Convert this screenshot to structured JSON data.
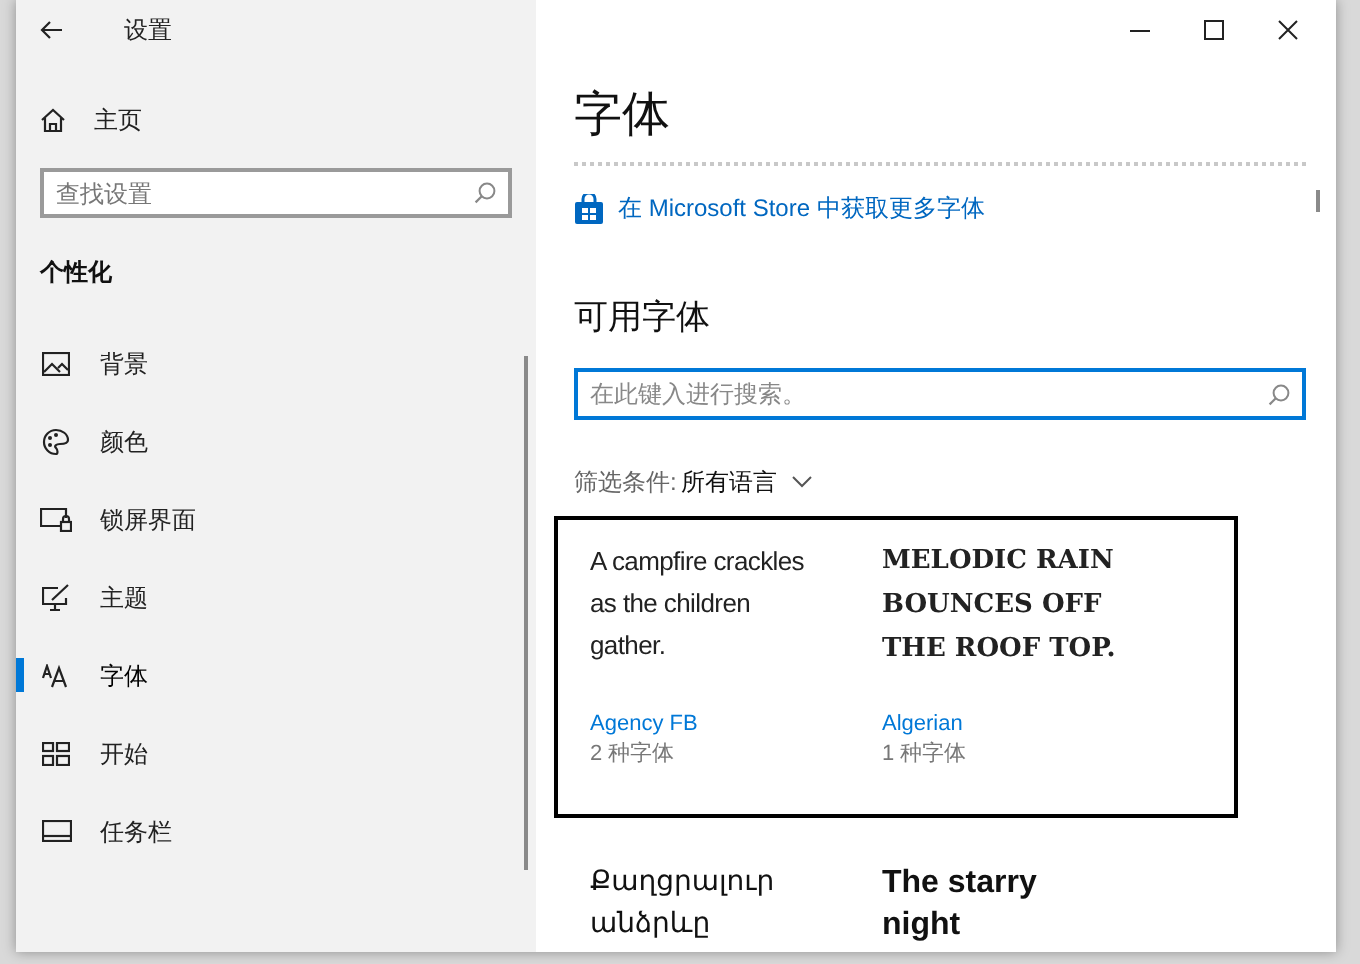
{
  "window": {
    "title": "设置"
  },
  "sidebar": {
    "home": "主页",
    "search": {
      "placeholder": "查找设置"
    },
    "section": "个性化",
    "items": [
      {
        "label": "背景",
        "selected": false
      },
      {
        "label": "颜色",
        "selected": false
      },
      {
        "label": "锁屏界面",
        "selected": false
      },
      {
        "label": "主题",
        "selected": false
      },
      {
        "label": "字体",
        "selected": true
      },
      {
        "label": "开始",
        "selected": false
      },
      {
        "label": "任务栏",
        "selected": false
      }
    ]
  },
  "content": {
    "title": "字体",
    "store_link": "在 Microsoft Store 中获取更多字体",
    "available_heading": "可用字体",
    "search": {
      "placeholder": "在此键入进行搜索。"
    },
    "filter": {
      "label": "筛选条件:",
      "value": "所有语言"
    },
    "font_cards": [
      {
        "sample": [
          "A campfire crackles",
          "as the children",
          "gather."
        ],
        "name": "Agency FB",
        "count": "2 种字体",
        "selected": true
      },
      {
        "sample": [
          "MELODIC RAIN",
          "BOUNCES OFF",
          "THE ROOF TOP."
        ],
        "name": "Algerian",
        "count": "1 种字体",
        "selected": true
      },
      {
        "sample": [
          "Քաղցրալուր",
          "անձրևը"
        ],
        "selected": false
      },
      {
        "sample": [
          "The starry",
          "night"
        ],
        "selected": false
      }
    ]
  }
}
